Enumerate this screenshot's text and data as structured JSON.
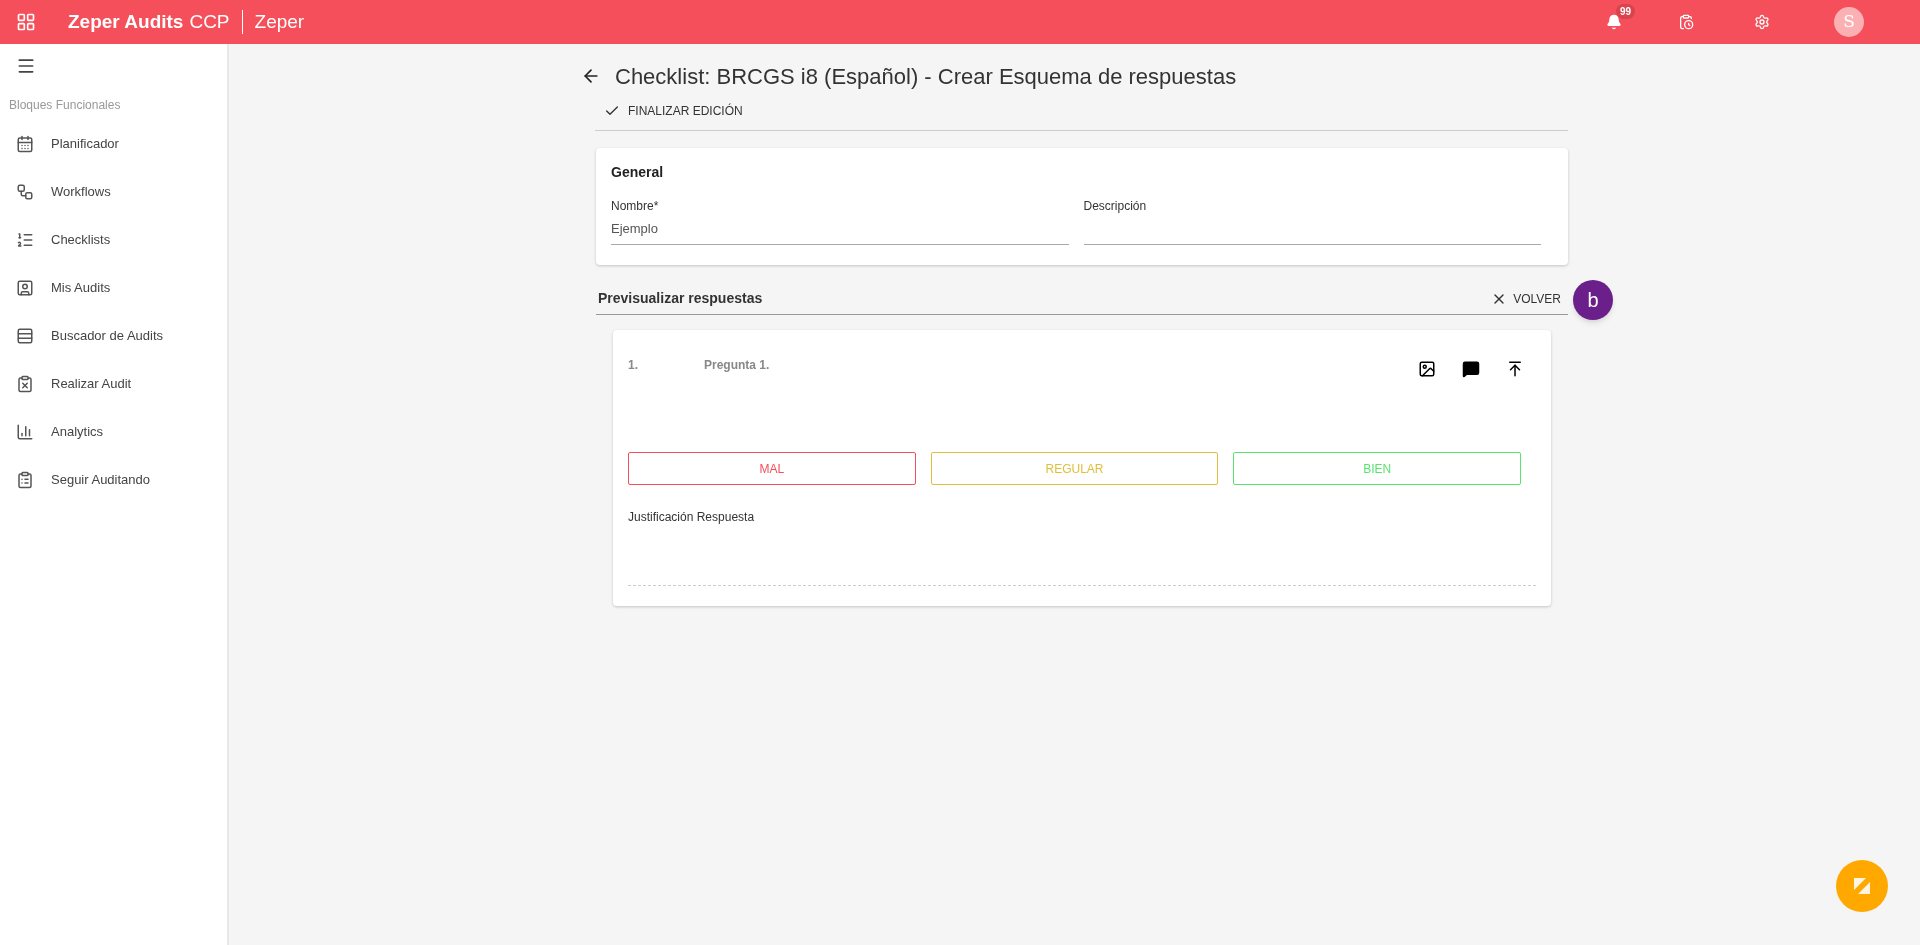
{
  "app_bar": {
    "app_name": "Zeper Audits",
    "app_suffix": "CCP",
    "organization": "Zeper",
    "notification_count": "99",
    "avatar_letter": "S"
  },
  "sidebar": {
    "section_title": "Bloques Funcionales",
    "items": [
      {
        "label": "Planificador"
      },
      {
        "label": "Workflows"
      },
      {
        "label": "Checklists"
      },
      {
        "label": "Mis Audits"
      },
      {
        "label": "Buscador de Audits"
      },
      {
        "label": "Realizar Audit"
      },
      {
        "label": "Analytics"
      },
      {
        "label": "Seguir Auditando"
      }
    ]
  },
  "page": {
    "title": "Checklist: BRCGS i8 (Español) - Crear Esquema de respuestas",
    "finish_button": "FINALIZAR EDICIÓN"
  },
  "general": {
    "title": "General",
    "fields": [
      {
        "label": "Nombre*",
        "value": "Ejemplo"
      },
      {
        "label": "Descripción"
      }
    ]
  },
  "preview": {
    "title": "Previsualizar respuestas",
    "back_button": "VOLVER",
    "fab_letter": "b",
    "question": {
      "number": "1.",
      "text": "Pregunta 1.",
      "answers": [
        {
          "label": "MAL",
          "color": "#f44f5a"
        },
        {
          "label": "REGULAR",
          "color": "#e0c03a"
        },
        {
          "label": "BIEN",
          "color": "#5be36f"
        }
      ],
      "justification_label": "Justificación Respuesta"
    }
  }
}
